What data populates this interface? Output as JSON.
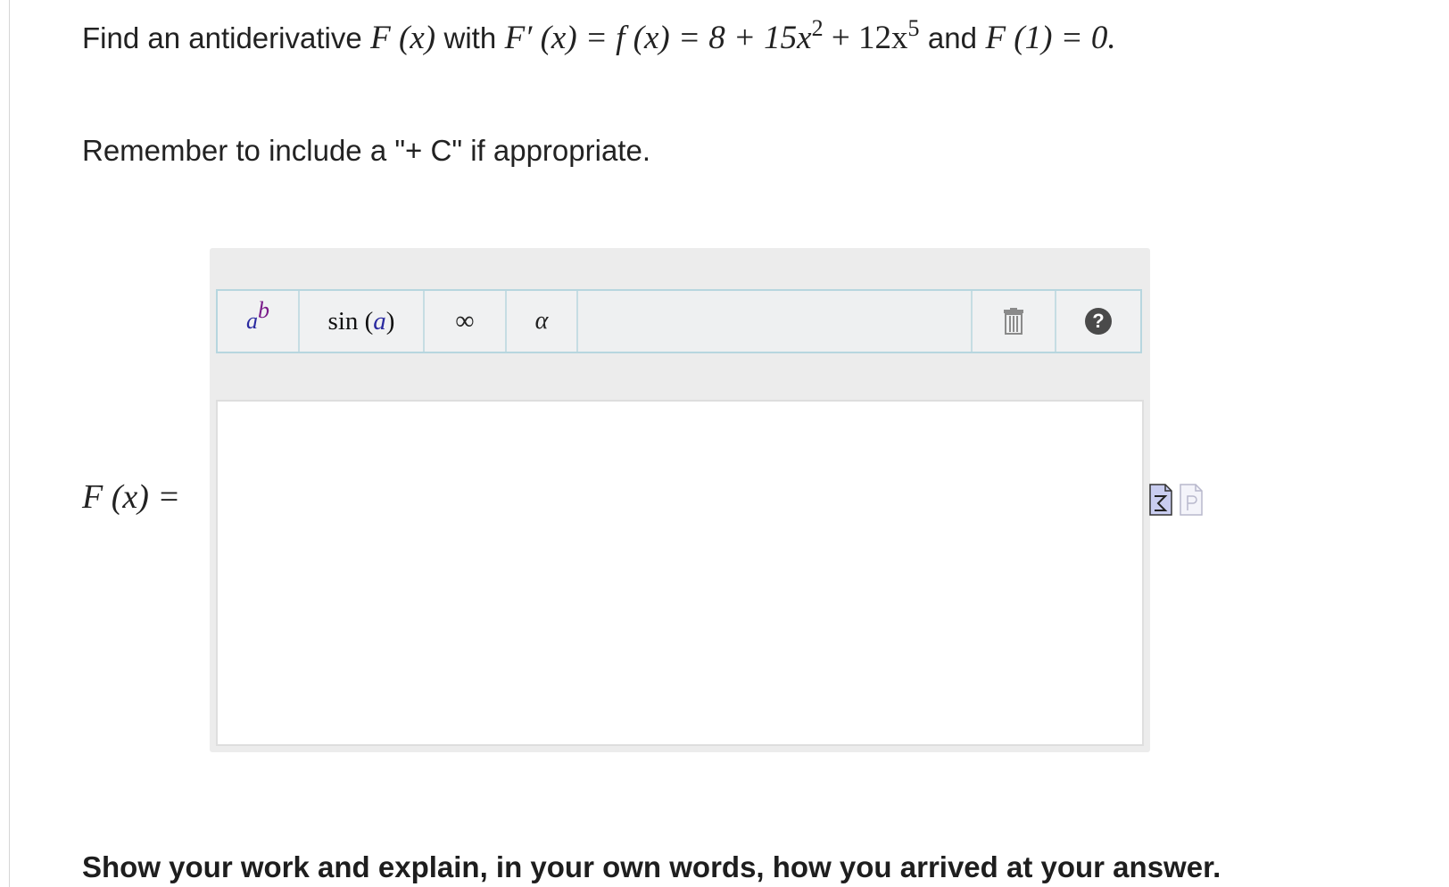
{
  "question": {
    "find": "Find an antiderivative",
    "fx": "F (x)",
    "with": "with",
    "Fprime": "F′ (x) = f (x) = 8 + 15x",
    "exp1": "2",
    "plus12x": " + 12x",
    "exp2": "5",
    "and": "and",
    "cond": "F (1) = 0."
  },
  "reminder": "Remember to include a \"+ C\" if appropriate.",
  "toolbar": {
    "power_base": "a",
    "power_exp": "b",
    "sin_fn": "sin (",
    "sin_arg": "a",
    "sin_close": ")",
    "infinity": "∞",
    "alpha": "α",
    "help": "?"
  },
  "answer": {
    "label": "F (x) =",
    "value": ""
  },
  "icons": [
    "trash-icon",
    "help-icon",
    "equation-editor-icon",
    "preview-icon"
  ],
  "instructions": "Show your work and explain, in your own words, how you arrived at your answer."
}
